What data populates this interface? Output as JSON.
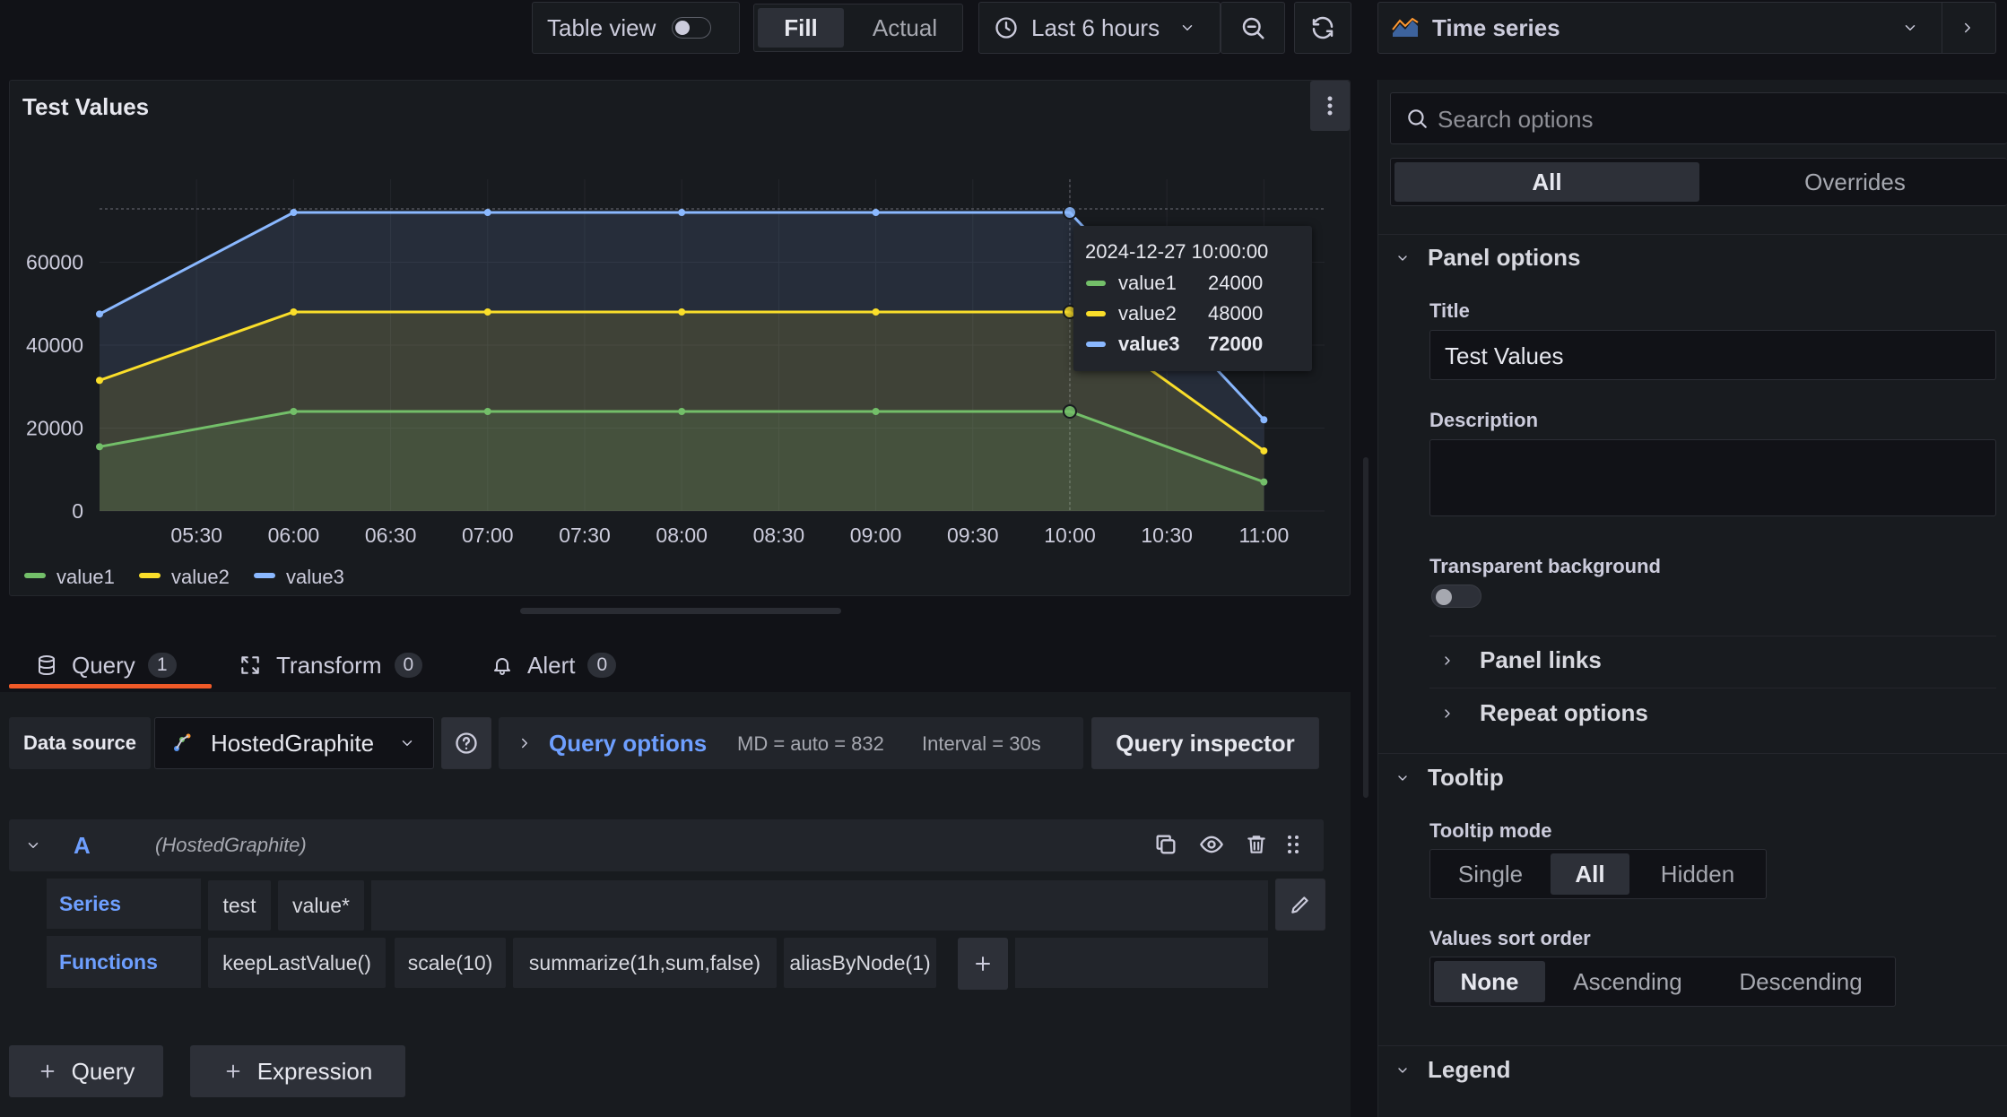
{
  "toolbar": {
    "table_view_label": "Table view",
    "fill_label": "Fill",
    "actual_label": "Actual",
    "time_range_label": "Last 6 hours",
    "viz_label": "Time series"
  },
  "panel": {
    "title": "Test Values",
    "tooltip": {
      "time": "2024-12-27 10:00:00",
      "rows": [
        {
          "name": "value1",
          "value": "24000"
        },
        {
          "name": "value2",
          "value": "48000"
        },
        {
          "name": "value3",
          "value": "72000"
        }
      ]
    }
  },
  "chart_data": {
    "type": "area",
    "x": [
      "05:00",
      "06:00",
      "07:00",
      "08:00",
      "09:00",
      "10:00",
      "11:00"
    ],
    "series": [
      {
        "name": "value1",
        "color": "#73bf69",
        "values": [
          15500,
          24000,
          24000,
          24000,
          24000,
          24000,
          7000
        ]
      },
      {
        "name": "value2",
        "color": "#fade2a",
        "values": [
          31500,
          48000,
          48000,
          48000,
          48000,
          48000,
          14500
        ]
      },
      {
        "name": "value3",
        "color": "#8ab8ff",
        "values": [
          47500,
          72000,
          72000,
          72000,
          72000,
          72000,
          22000
        ]
      }
    ],
    "x_ticks": [
      "05:30",
      "06:00",
      "06:30",
      "07:00",
      "07:30",
      "08:00",
      "08:30",
      "09:00",
      "09:30",
      "10:00",
      "10:30",
      "11:00"
    ],
    "y_ticks": [
      "0",
      "20000",
      "40000",
      "60000"
    ],
    "ylim": [
      0,
      80000
    ],
    "grid": true,
    "legend": "bottom-left",
    "legend_labels": [
      "value1",
      "value2",
      "value3"
    ]
  },
  "tabs": {
    "query_label": "Query",
    "query_count": "1",
    "transform_label": "Transform",
    "transform_count": "0",
    "alert_label": "Alert",
    "alert_count": "0"
  },
  "query_bar": {
    "data_source_label": "Data source",
    "data_source_value": "HostedGraphite",
    "query_options_label": "Query options",
    "md_text": "MD = auto = 832",
    "interval_text": "Interval = 30s",
    "inspector_label": "Query inspector"
  },
  "query_row": {
    "ref_id": "A",
    "source_hint": "(HostedGraphite)",
    "series_label": "Series",
    "series_chips": [
      "test",
      "value*"
    ],
    "functions_label": "Functions",
    "function_chips": [
      "keepLastValue()",
      "scale(10)",
      "summarize(1h,sum,false)",
      "aliasByNode(1)"
    ]
  },
  "add_buttons": {
    "query_label": "Query",
    "expression_label": "Expression"
  },
  "options": {
    "search_placeholder": "Search options",
    "tab_all": "All",
    "tab_overrides": "Overrides",
    "panel_options_heading": "Panel options",
    "title_label": "Title",
    "title_value": "Test Values",
    "description_label": "Description",
    "transparent_label": "Transparent background",
    "panel_links": "Panel links",
    "repeat_options": "Repeat options",
    "tooltip_heading": "Tooltip",
    "tooltip_mode_label": "Tooltip mode",
    "tooltip_modes": [
      "Single",
      "All",
      "Hidden"
    ],
    "sort_label": "Values sort order",
    "sort_modes": [
      "None",
      "Ascending",
      "Descending"
    ],
    "legend_heading": "Legend"
  }
}
